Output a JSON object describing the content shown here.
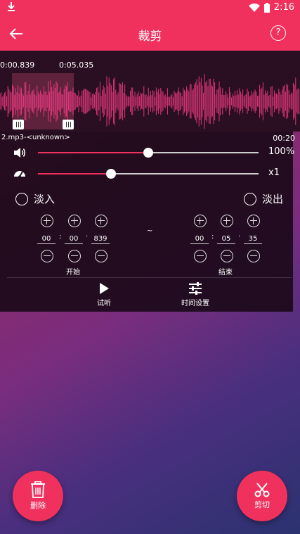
{
  "status_bar": {
    "time": "2:16"
  },
  "app_bar": {
    "title": "裁剪",
    "help_label": "?"
  },
  "waveform": {
    "start_marker": "0:00.839",
    "end_marker": "0:05.035"
  },
  "file": {
    "name": "2.mp3-<unknown>",
    "duration": "00:20"
  },
  "volume": {
    "label": "100%",
    "level": 0.5
  },
  "speed": {
    "label": "x1",
    "level": 0.33
  },
  "fade": {
    "fade_in": "淡入",
    "fade_out": "淡出"
  },
  "start_time": {
    "minutes": "00",
    "seconds": "00",
    "millis": "839",
    "label": "开始"
  },
  "tilde": "~",
  "end_time": {
    "minutes": "00",
    "seconds": "05",
    "millis": "35",
    "label": "结束"
  },
  "actions": {
    "preview": "试听",
    "time_settings": "时间设置"
  },
  "fabs": {
    "delete": "删除",
    "cut": "剪切"
  },
  "colors": {
    "accent": "#f0315e",
    "wave": "#ff3d8a"
  }
}
